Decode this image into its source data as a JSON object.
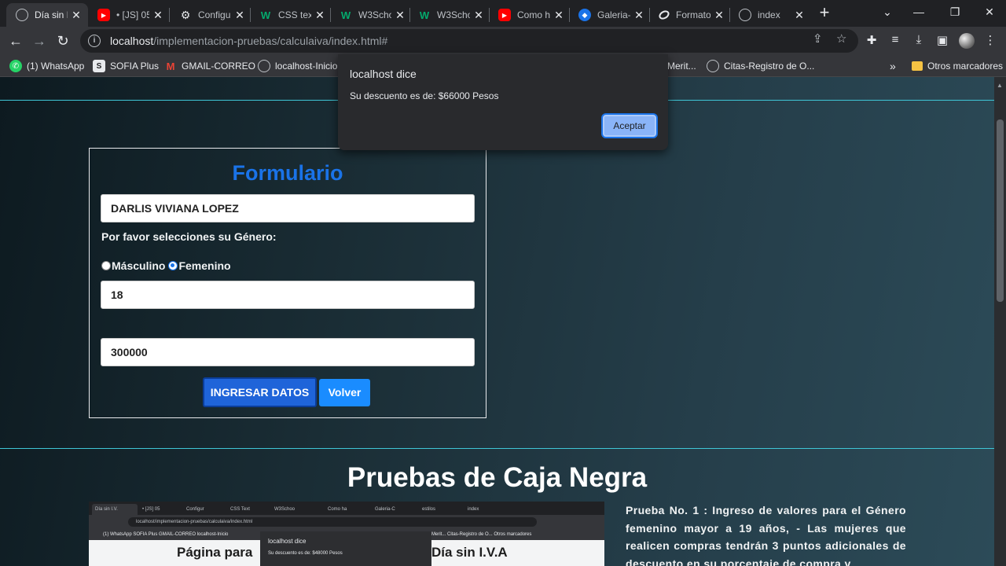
{
  "browser": {
    "tabs": [
      {
        "title": "Día sin I",
        "icon": "globe-icon",
        "active": true
      },
      {
        "title": "• [JS] 05",
        "icon": "youtube-icon"
      },
      {
        "title": "Configur",
        "icon": "gear-icon"
      },
      {
        "title": "CSS text",
        "icon": "w3schools-icon"
      },
      {
        "title": "W3Scho",
        "icon": "w3schools-icon"
      },
      {
        "title": "W3Scho",
        "icon": "w3schools-icon"
      },
      {
        "title": "Como h",
        "icon": "youtube-icon"
      },
      {
        "title": "Galeria-",
        "icon": "galeria-icon"
      },
      {
        "title": "Formato",
        "icon": "formato-icon"
      },
      {
        "title": "index",
        "icon": "globe-icon"
      }
    ],
    "new_tab": "+",
    "url_host": "localhost",
    "url_path": "/implementacion-pruebas/calculaiva/index.html#",
    "bookmarks": [
      {
        "label": "(1) WhatsApp",
        "icon": "whatsapp-icon"
      },
      {
        "label": "SOFIA Plus",
        "icon": "sofia-icon"
      },
      {
        "label": "GMAIL-CORREO",
        "icon": "gmail-icon"
      },
      {
        "label": "localhost-Inicio",
        "icon": "globe-icon"
      },
      {
        "label": "Merit...",
        "icon": "bookmark-icon"
      },
      {
        "label": "Citas-Registro de O...",
        "icon": "globe-icon"
      }
    ],
    "more_bookmarks": "»",
    "other_bookmarks": "Otros marcadores"
  },
  "alert": {
    "title": "localhost dice",
    "message": "Su descuento es de: $66000  Pesos",
    "ok_label": "Aceptar"
  },
  "form": {
    "title": "Formulario",
    "name_value": "DARLIS VIVIANA LOPEZ",
    "gender_prompt": "Por favor selecciones su Género:",
    "gender_options": [
      "Másculino",
      "Femenino"
    ],
    "gender_selected": "Femenino",
    "age_value": "18",
    "amount_value": "300000",
    "submit_label": "INGRESAR DATOS",
    "back_label": "Volver"
  },
  "section": {
    "title": "Pruebas de Caja Negra",
    "thumbnail": {
      "tabs": [
        "Día sin I.V.",
        "• [JS] 05",
        "Configur",
        "CSS Text",
        "W3Schoo",
        "Como ha",
        "Galeria-C",
        "estilos",
        "index"
      ],
      "url": "localhost/implementacion-pruebas/calculaiva/index.html",
      "bookmarks": "(1) WhatsApp    SOFIA Plus    GMAIL-CORREO    localhost-Inicio",
      "bookmarks_right": "Merit...    Citas-Registro de O...      Otros marcadores",
      "heading_left": "Página para",
      "heading_right": "Día sin I.V.A",
      "alert_title": "localhost dice",
      "alert_message": "Su descuento es de: $48000  Pesos"
    },
    "description": "Prueba No. 1 : Ingreso de valores para el Género femenino mayor a 19 años, - Las mujeres que realicen compras tendrán 3 puntos adicionales de descuento en su porcentaje de compra y"
  }
}
